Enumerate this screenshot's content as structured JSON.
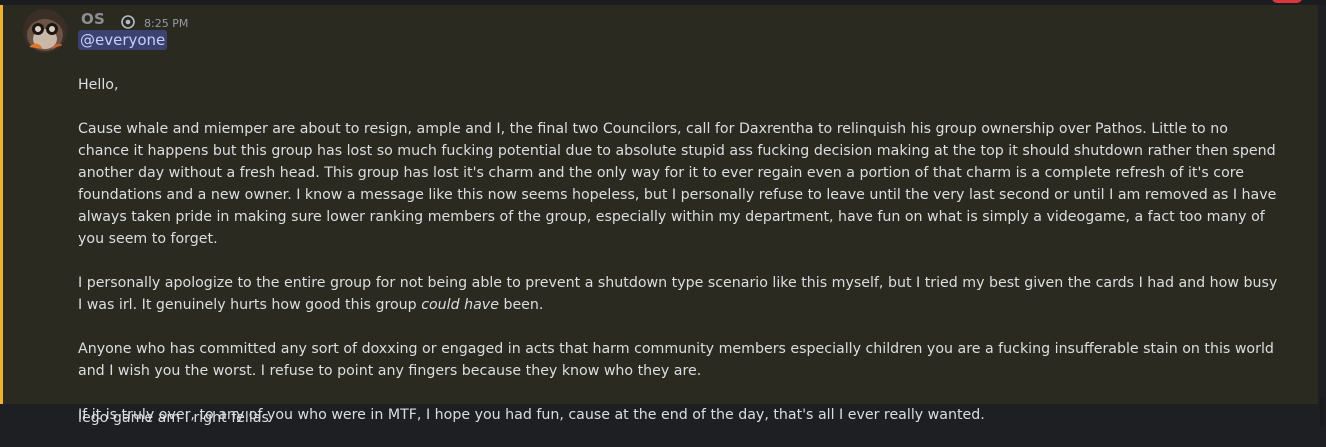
{
  "message": {
    "author": "OS",
    "author_icon": "gear-role-icon",
    "timestamp": "8:25 PM",
    "mention": "@everyone",
    "highlight_color": "#f0b232",
    "mention_bg": "#3c4270",
    "paragraphs": {
      "p1": "Hello,",
      "p2": "Cause whale and miemper are about to resign, ample and I, the final two Councilors, call for Daxrentha to relinquish his group ownership over Pathos. Little to no chance it happens but this group has lost so much fucking potential due to absolute stupid ass fucking decision making at the top it should shutdown rather then spend another day without a fresh head. This group has lost it's charm and the only way for it to ever regain even a portion of that charm is a complete refresh of it's core foundations and a new owner. I know a message like this now seems hopeless, but I personally refuse to leave until the very last second or until I am removed as I have always taken pride in making sure lower ranking members of the group, especially within my department, have fun on what is simply a videogame, a fact too many of you seem to forget.",
      "p3_start": "I personally apologize to the entire group for not being able to prevent a shutdown type scenario like this myself, but I tried my best given the cards I had and how busy I was irl. It genuinely hurts how good this group ",
      "p3_italic": "could have",
      "p3_end": " been.",
      "p4": "Anyone who has committed any sort of doxxing or engaged in acts that harm community members especially children you are a fucking insufferable stain on this world and I wish you the worst. I refuse to point any fingers because they know who they are.",
      "p5": "If it is truly over, to any of you who were in MTF, I hope you had fun, cause at the end of the day, that's all I ever really wanted."
    }
  },
  "next_message": {
    "text": "lego game am I right fellas"
  }
}
